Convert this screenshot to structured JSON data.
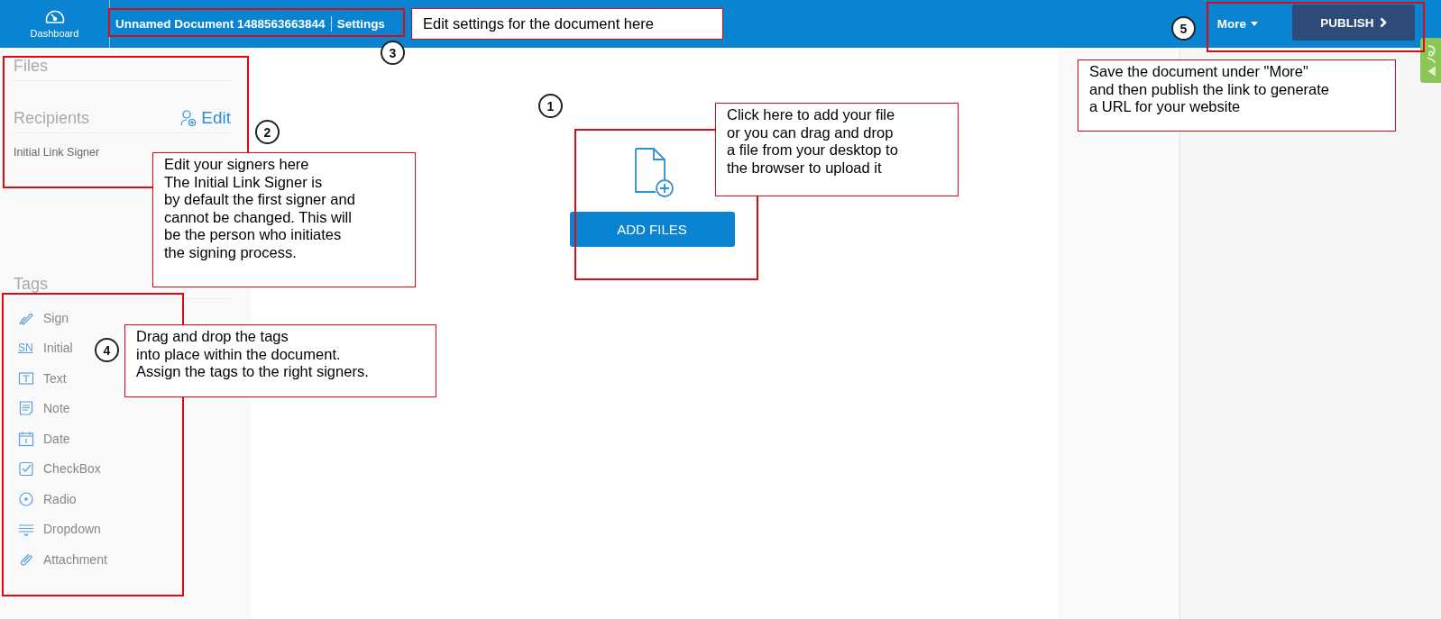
{
  "header": {
    "dashboard_label": "Dashboard",
    "document_title": "Unnamed Document 1488563663844",
    "settings_link": "Settings",
    "more_menu": "More",
    "publish_button": "PUBLISH"
  },
  "sidebar": {
    "files_heading": "Files",
    "recipients_heading": "Recipients",
    "edit_link": "Edit",
    "recipients": [
      "Initial Link Signer"
    ],
    "tags_heading": "Tags",
    "tags": [
      {
        "kind": "sign",
        "label": "Sign"
      },
      {
        "kind": "initial",
        "icon_text": "SN",
        "label": "Initial"
      },
      {
        "kind": "text",
        "label": "Text"
      },
      {
        "kind": "note",
        "label": "Note"
      },
      {
        "kind": "date",
        "label": "Date"
      },
      {
        "kind": "checkbox",
        "label": "CheckBox"
      },
      {
        "kind": "radio",
        "label": "Radio"
      },
      {
        "kind": "dropdown",
        "label": "Dropdown"
      },
      {
        "kind": "attachment",
        "label": "Attachment"
      }
    ]
  },
  "upload": {
    "button": "ADD FILES"
  },
  "annotations": [
    {
      "number": "1",
      "callout": "Click here to add your file\nor you can drag and drop\na file from your desktop to\nthe browser to upload it"
    },
    {
      "number": "2",
      "callout": "Edit your signers here\nThe Initial Link Signer is\nby default the first signer and\ncannot be changed. This will\nbe the person who initiates\nthe signing process."
    },
    {
      "number": "3",
      "callout": "Edit settings for the document here"
    },
    {
      "number": "4",
      "callout": "Drag and drop the tags\ninto place within the document.\nAssign the tags to the right signers."
    },
    {
      "number": "5",
      "callout": "Save the document under \"More\"\nand then publish the link to generate\na URL for your website"
    }
  ]
}
